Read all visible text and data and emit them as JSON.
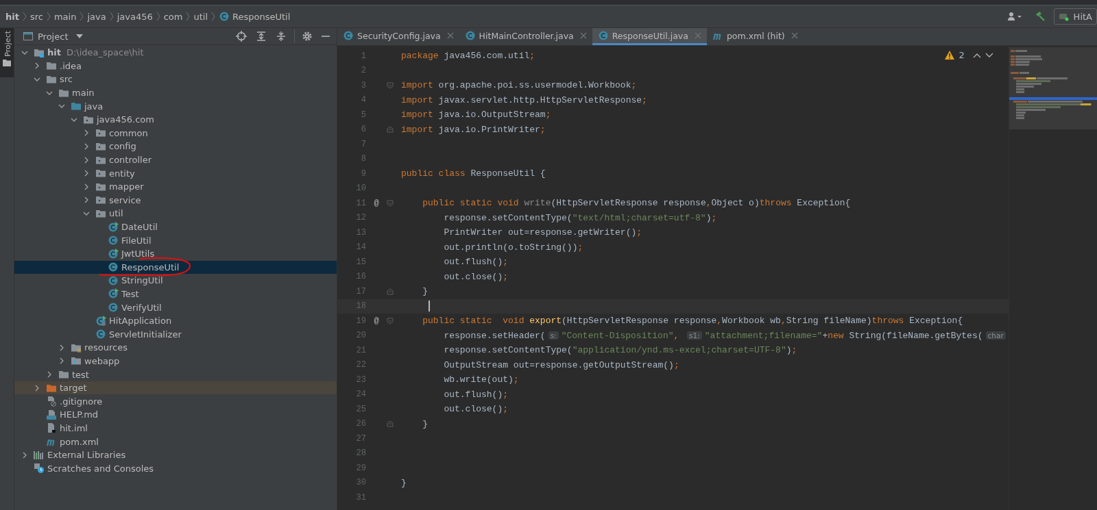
{
  "breadcrumb": [
    {
      "label": "hit",
      "kind": "module"
    },
    {
      "label": "src",
      "kind": "dir"
    },
    {
      "label": "main",
      "kind": "dir"
    },
    {
      "label": "java",
      "kind": "dir"
    },
    {
      "label": "java456",
      "kind": "dir"
    },
    {
      "label": "com",
      "kind": "dir"
    },
    {
      "label": "util",
      "kind": "dir"
    },
    {
      "label": "ResponseUtil",
      "kind": "class"
    }
  ],
  "run_config": {
    "label": "HitA"
  },
  "side_stripe": {
    "label": "Project",
    "selected": true
  },
  "project_panel": {
    "title": "Project"
  },
  "tree": [
    {
      "label": "hit",
      "path": "D:\\idea_space\\hit",
      "kind": "module",
      "expanded": true,
      "selected": false,
      "children": [
        {
          "label": ".idea",
          "kind": "folder",
          "expanded": false,
          "selected": false
        },
        {
          "label": "src",
          "kind": "folder",
          "expanded": true,
          "selected": false,
          "children": [
            {
              "label": "main",
              "kind": "folder",
              "expanded": true,
              "selected": false,
              "children": [
                {
                  "label": "java",
                  "kind": "source",
                  "expanded": true,
                  "selected": false,
                  "children": [
                    {
                      "label": "java456.com",
                      "kind": "package",
                      "expanded": true,
                      "selected": false,
                      "children": [
                        {
                          "label": "common",
                          "kind": "package",
                          "expanded": false,
                          "selected": false
                        },
                        {
                          "label": "config",
                          "kind": "package",
                          "expanded": false,
                          "selected": false
                        },
                        {
                          "label": "controller",
                          "kind": "package",
                          "expanded": false,
                          "selected": false
                        },
                        {
                          "label": "entity",
                          "kind": "package",
                          "expanded": false,
                          "selected": false
                        },
                        {
                          "label": "mapper",
                          "kind": "package",
                          "expanded": false,
                          "selected": false
                        },
                        {
                          "label": "service",
                          "kind": "package",
                          "expanded": false,
                          "selected": false
                        },
                        {
                          "label": "util",
                          "kind": "package",
                          "expanded": true,
                          "selected": false,
                          "children": [
                            {
                              "label": "DateUtil",
                              "kind": "class-run",
                              "selected": false
                            },
                            {
                              "label": "FileUtil",
                              "kind": "class",
                              "selected": false
                            },
                            {
                              "label": "JwtUtils",
                              "kind": "class-run",
                              "selected": false
                            },
                            {
                              "label": "ResponseUtil",
                              "kind": "class",
                              "selected": true,
                              "circled": true
                            },
                            {
                              "label": "StringUtil",
                              "kind": "class",
                              "selected": false
                            },
                            {
                              "label": "Test",
                              "kind": "class-run",
                              "selected": false
                            },
                            {
                              "label": "VerifyUtil",
                              "kind": "class",
                              "selected": false
                            }
                          ]
                        },
                        {
                          "label": "HitApplication",
                          "kind": "spring-app",
                          "selected": false
                        },
                        {
                          "label": "ServletInitializer",
                          "kind": "class",
                          "selected": false
                        }
                      ]
                    }
                  ]
                },
                {
                  "label": "resources",
                  "kind": "resources",
                  "expanded": false,
                  "selected": false
                },
                {
                  "label": "webapp",
                  "kind": "web",
                  "expanded": false,
                  "selected": false
                }
              ]
            },
            {
              "label": "test",
              "kind": "folder",
              "expanded": false,
              "selected": false
            }
          ]
        },
        {
          "label": "target",
          "kind": "excluded",
          "expanded": false,
          "selected": false,
          "excluded": true
        },
        {
          "label": ".gitignore",
          "kind": "gitignore",
          "selected": false
        },
        {
          "label": "HELP.md",
          "kind": "markdown",
          "selected": false
        },
        {
          "label": "hit.iml",
          "kind": "iml",
          "selected": false
        },
        {
          "label": "pom.xml",
          "kind": "maven",
          "selected": false
        }
      ]
    },
    {
      "label": "External Libraries",
      "kind": "libraries",
      "expanded": false,
      "selected": false
    },
    {
      "label": "Scratches and Consoles",
      "kind": "scratches",
      "selected": false
    }
  ],
  "tabs": [
    {
      "label": "SecurityConfig.java",
      "kind": "class",
      "selected": false
    },
    {
      "label": "HitMainController.java",
      "kind": "class",
      "selected": false
    },
    {
      "label": "ResponseUtil.java",
      "kind": "class",
      "selected": true
    },
    {
      "label": "pom.xml (hit)",
      "kind": "maven",
      "selected": false
    }
  ],
  "inspections": {
    "warnings": "2"
  },
  "code": [
    {
      "number": "1",
      "tokens": [
        {
          "kind": "kw",
          "text": "package"
        },
        {
          "kind": "p",
          "text": " java456.com.util"
        },
        {
          "kind": "kw",
          "text": ";"
        }
      ]
    },
    {
      "number": "2"
    },
    {
      "number": "3",
      "fold_start": true,
      "tokens": [
        {
          "kind": "kw",
          "text": "import"
        },
        {
          "kind": "p",
          "text": " org.apache.poi.ss.usermodel.Workbook"
        },
        {
          "kind": "kw",
          "text": ";"
        }
      ]
    },
    {
      "number": "4",
      "tokens": [
        {
          "kind": "kw",
          "text": "import"
        },
        {
          "kind": "p",
          "text": " javax.servlet.http.HttpServletResponse"
        },
        {
          "kind": "kw",
          "text": ";"
        }
      ]
    },
    {
      "number": "5",
      "tokens": [
        {
          "kind": "kw",
          "text": "import"
        },
        {
          "kind": "p",
          "text": " java.io.OutputStream"
        },
        {
          "kind": "kw",
          "text": ";"
        }
      ]
    },
    {
      "number": "6",
      "fold_end": true,
      "tokens": [
        {
          "kind": "kw",
          "text": "import"
        },
        {
          "kind": "p",
          "text": " java.io.PrintWriter"
        },
        {
          "kind": "kw",
          "text": ";"
        }
      ]
    },
    {
      "number": "7"
    },
    {
      "number": "8"
    },
    {
      "number": "9",
      "tokens": [
        {
          "kind": "kw",
          "text": "public class "
        },
        {
          "kind": "p",
          "text": "ResponseUtil {"
        }
      ]
    },
    {
      "number": "10"
    },
    {
      "number": "11",
      "gutter": "@",
      "fold_start": true,
      "tokens": [
        {
          "kind": "kw",
          "text": "    public static void "
        },
        {
          "kind": "dim",
          "text": "write"
        },
        {
          "kind": "p",
          "text": "(HttpServletResponse response"
        },
        {
          "kind": "kw",
          "text": ","
        },
        {
          "kind": "p",
          "text": "Object o)"
        },
        {
          "kind": "kw",
          "text": "throws "
        },
        {
          "kind": "p",
          "text": "Exception{"
        }
      ]
    },
    {
      "number": "12",
      "tokens": [
        {
          "kind": "p",
          "text": "        response.setContentType("
        },
        {
          "kind": "str",
          "text": "\"text/html;charset=utf-8\""
        },
        {
          "kind": "p",
          "text": ")"
        },
        {
          "kind": "kw",
          "text": ";"
        }
      ]
    },
    {
      "number": "13",
      "tokens": [
        {
          "kind": "p",
          "text": "        PrintWriter out=response.getWriter()"
        },
        {
          "kind": "kw",
          "text": ";"
        }
      ]
    },
    {
      "number": "14",
      "tokens": [
        {
          "kind": "p",
          "text": "        out.println(o.toString())"
        },
        {
          "kind": "kw",
          "text": ";"
        }
      ]
    },
    {
      "number": "15",
      "tokens": [
        {
          "kind": "p",
          "text": "        out.flush()"
        },
        {
          "kind": "kw",
          "text": ";"
        }
      ]
    },
    {
      "number": "16",
      "tokens": [
        {
          "kind": "p",
          "text": "        out.close()"
        },
        {
          "kind": "kw",
          "text": ";"
        }
      ]
    },
    {
      "number": "17",
      "fold_end": true,
      "tokens": [
        {
          "kind": "p",
          "text": "    }"
        }
      ]
    },
    {
      "number": "18",
      "current": true,
      "caret": true
    },
    {
      "number": "19",
      "gutter": "@",
      "fold_start": true,
      "tokens": [
        {
          "kind": "kw",
          "text": "    public static  void "
        },
        {
          "kind": "fn",
          "text": "export"
        },
        {
          "kind": "p",
          "text": "(HttpServletResponse response"
        },
        {
          "kind": "kw",
          "text": ","
        },
        {
          "kind": "p",
          "text": "Workbook wb"
        },
        {
          "kind": "kw",
          "text": ","
        },
        {
          "kind": "p",
          "text": "String fileName)"
        },
        {
          "kind": "kw",
          "text": "throws "
        },
        {
          "kind": "p",
          "text": "Exception{"
        }
      ]
    },
    {
      "number": "20",
      "tokens": [
        {
          "kind": "p",
          "text": "        response.setHeader("
        },
        {
          "kind": "hint",
          "text": "s:"
        },
        {
          "kind": "str",
          "text": "\"Content-Disposition\""
        },
        {
          "kind": "kw",
          "text": ", "
        },
        {
          "kind": "hint",
          "text": "s1:"
        },
        {
          "kind": "str",
          "text": "\"attachment;filename=\""
        },
        {
          "kind": "p",
          "text": "+"
        },
        {
          "kind": "kw",
          "text": "new "
        },
        {
          "kind": "p",
          "text": "String(fileName.getBytes("
        },
        {
          "kind": "hint",
          "text": "char"
        }
      ]
    },
    {
      "number": "21",
      "tokens": [
        {
          "kind": "p",
          "text": "        response.setContentType("
        },
        {
          "kind": "str",
          "text": "\"application/ynd.ms-excel;charset=UTF-8\""
        },
        {
          "kind": "p",
          "text": ")"
        },
        {
          "kind": "kw",
          "text": ";"
        }
      ]
    },
    {
      "number": "22",
      "tokens": [
        {
          "kind": "p",
          "text": "        OutputStream out=response.getOutputStream()"
        },
        {
          "kind": "kw",
          "text": ";"
        }
      ]
    },
    {
      "number": "23",
      "tokens": [
        {
          "kind": "p",
          "text": "        wb.write(out)"
        },
        {
          "kind": "kw",
          "text": ";"
        }
      ]
    },
    {
      "number": "24",
      "tokens": [
        {
          "kind": "p",
          "text": "        out.flush()"
        },
        {
          "kind": "kw",
          "text": ";"
        }
      ]
    },
    {
      "number": "25",
      "tokens": [
        {
          "kind": "p",
          "text": "        out.close()"
        },
        {
          "kind": "kw",
          "text": ";"
        }
      ]
    },
    {
      "number": "26",
      "fold_end": true,
      "tokens": [
        {
          "kind": "p",
          "text": "    }"
        }
      ]
    },
    {
      "number": "27"
    },
    {
      "number": "28"
    },
    {
      "number": "29"
    },
    {
      "number": "30",
      "tokens": [
        {
          "kind": "p",
          "text": "}"
        }
      ]
    },
    {
      "number": "31"
    }
  ]
}
